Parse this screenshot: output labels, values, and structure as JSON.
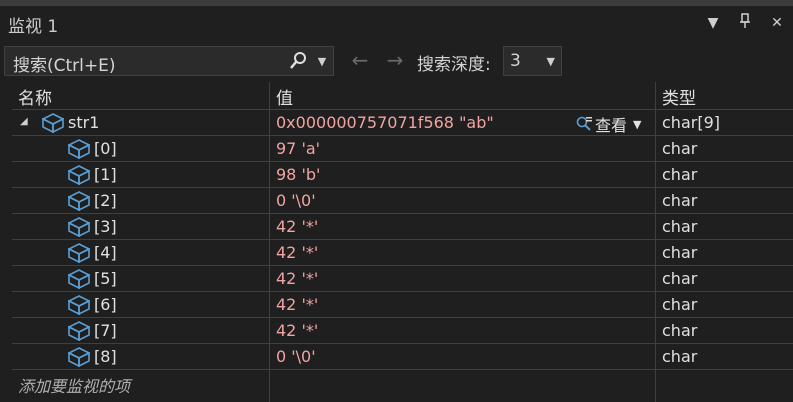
{
  "window": {
    "title": "监视 1",
    "buttons": [
      "chevron-down-icon",
      "pin-icon",
      "close-icon"
    ]
  },
  "toolbar": {
    "search_text": "搜索(Ctrl+E)",
    "depth_label": "搜索深度:",
    "depth_value": "3"
  },
  "columns": {
    "name": "名称",
    "value": "值",
    "type": "类型"
  },
  "rows": [
    {
      "name": "str1",
      "value": "0x000000757071f568 \"ab\"",
      "type": "char[9]",
      "view": "查看"
    },
    {
      "name": "[0]",
      "value": "97 'a'",
      "type": "char"
    },
    {
      "name": "[1]",
      "value": "98 'b'",
      "type": "char"
    },
    {
      "name": "[2]",
      "value": "0 '\\0'",
      "type": "char"
    },
    {
      "name": "[3]",
      "value": "42 '*'",
      "type": "char"
    },
    {
      "name": "[4]",
      "value": "42 '*'",
      "type": "char"
    },
    {
      "name": "[5]",
      "value": "42 '*'",
      "type": "char"
    },
    {
      "name": "[6]",
      "value": "42 '*'",
      "type": "char"
    },
    {
      "name": "[7]",
      "value": "42 '*'",
      "type": "char"
    },
    {
      "name": "[8]",
      "value": "0 '\\0'",
      "type": "char"
    }
  ],
  "add_watch": "添加要监视的项",
  "colors": {
    "value_text": "#f1a3a3",
    "background": "#1f1f1f",
    "cube_icon": "#5a9fd4"
  }
}
